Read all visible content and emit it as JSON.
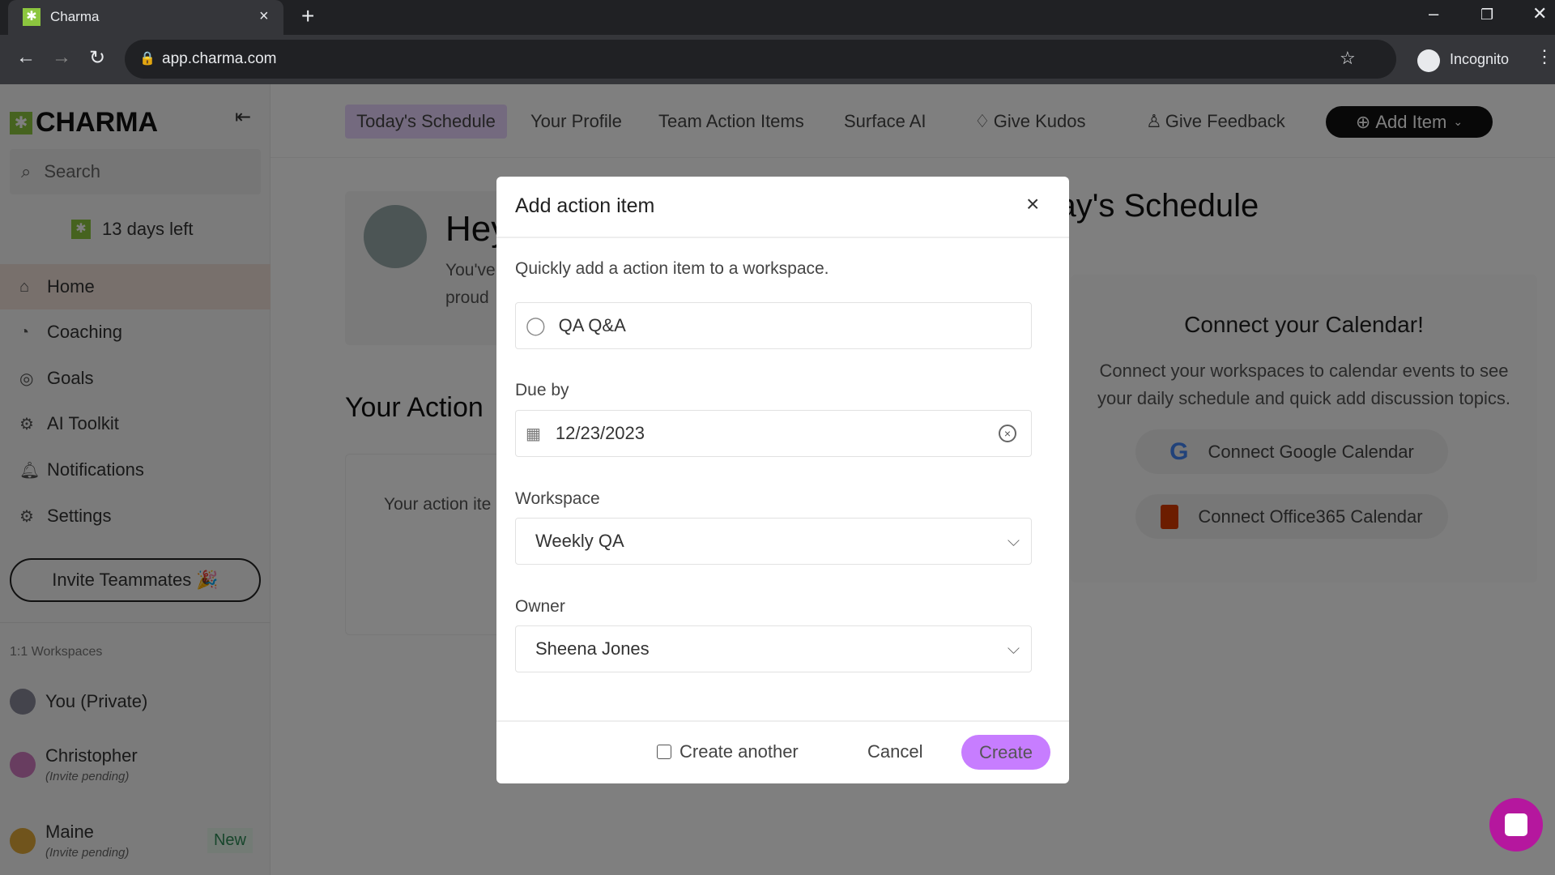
{
  "browser": {
    "tab_title": "Charma",
    "url": "app.charma.com",
    "profile": "Incognito"
  },
  "sidebar": {
    "logo": "CHARMA",
    "search_placeholder": "Search",
    "trial": "13 days left",
    "items": [
      {
        "label": "Home",
        "icon": "home-icon"
      },
      {
        "label": "Coaching",
        "icon": "coaching-icon"
      },
      {
        "label": "Goals",
        "icon": "target-icon"
      },
      {
        "label": "AI Toolkit",
        "icon": "robot-icon"
      },
      {
        "label": "Notifications",
        "icon": "bell-icon"
      },
      {
        "label": "Settings",
        "icon": "gear-icon"
      }
    ],
    "invite": "Invite Teammates 🎉",
    "workspaces_heading": "1:1 Workspaces",
    "workspaces": [
      {
        "name": "You (Private)",
        "sub": ""
      },
      {
        "name": "Christopher",
        "sub": "(Invite pending)"
      },
      {
        "name": "Maine",
        "sub": "(Invite pending)",
        "badge": "New"
      }
    ]
  },
  "topnav": {
    "tabs": [
      "Today's Schedule",
      "Your Profile",
      "Team Action Items",
      "Surface AI"
    ],
    "kudos": "Give Kudos",
    "feedback": "Give Feedback",
    "add_item": "Add Item"
  },
  "main": {
    "greeting": "Hey",
    "greeting_l1": "You've",
    "greeting_l2": "proud",
    "action_title": "Your Action",
    "action_text": "Your action ite",
    "schedule_title": "Today's Schedule",
    "calendar": {
      "title": "Connect your Calendar!",
      "text_l1": "Connect your workspaces to calendar events to see",
      "text_l2": "your daily schedule and quick add discussion topics.",
      "google": "Connect Google Calendar",
      "office": "Connect Office365 Calendar"
    }
  },
  "modal": {
    "title": "Add action item",
    "description": "Quickly add a action item to a workspace.",
    "item_value": "QA Q&A",
    "due_label": "Due by",
    "due_value": "12/23/2023",
    "workspace_label": "Workspace",
    "workspace_value": "Weekly QA",
    "owner_label": "Owner",
    "owner_value": "Sheena Jones",
    "create_another": "Create another",
    "create_another_checked": false,
    "cancel": "Cancel",
    "create": "Create"
  },
  "colors": {
    "accent": "#c77dff",
    "highlight": "#e9d5ff",
    "chat": "#b5179e",
    "logo_green": "#8cc63f"
  }
}
